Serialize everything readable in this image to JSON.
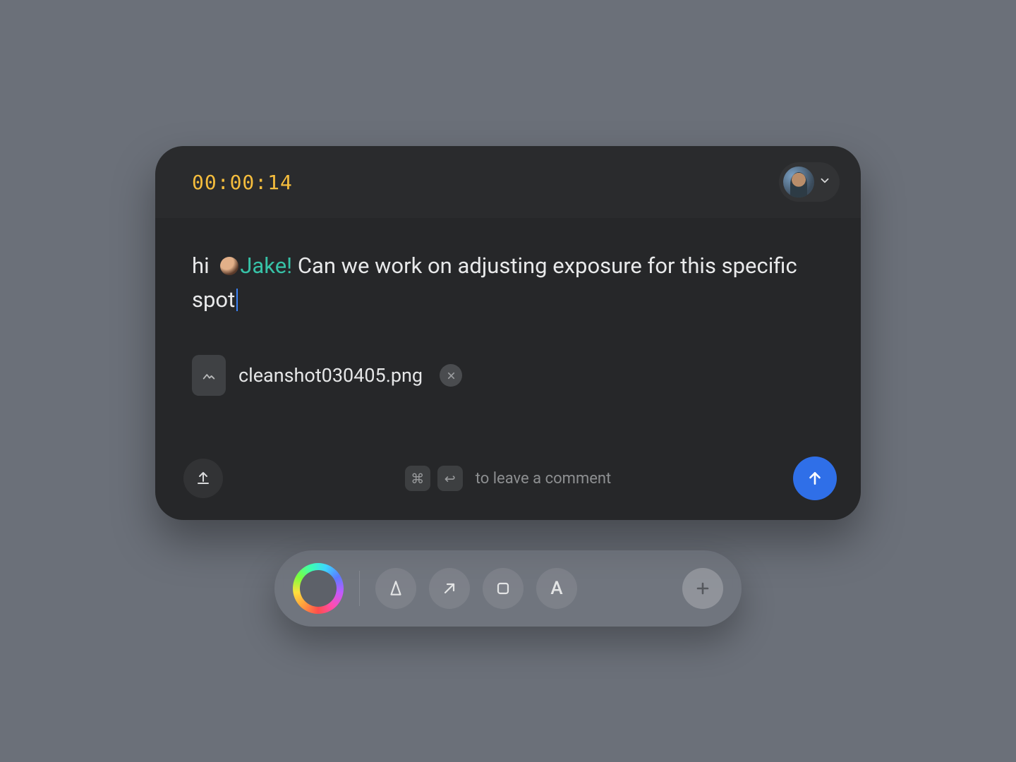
{
  "header": {
    "timestamp": "00:00:14"
  },
  "comment": {
    "prefix": "hi",
    "mention_name": "Jake!",
    "rest": " Can we work on adjusting exposure for this specific spot"
  },
  "attachment": {
    "filename": "cleanshot030405.png"
  },
  "footer": {
    "kbd_cmd": "⌘",
    "kbd_enter": "↩",
    "hint": "to leave a comment"
  },
  "toolbar": {
    "text_tool_label": "A"
  }
}
